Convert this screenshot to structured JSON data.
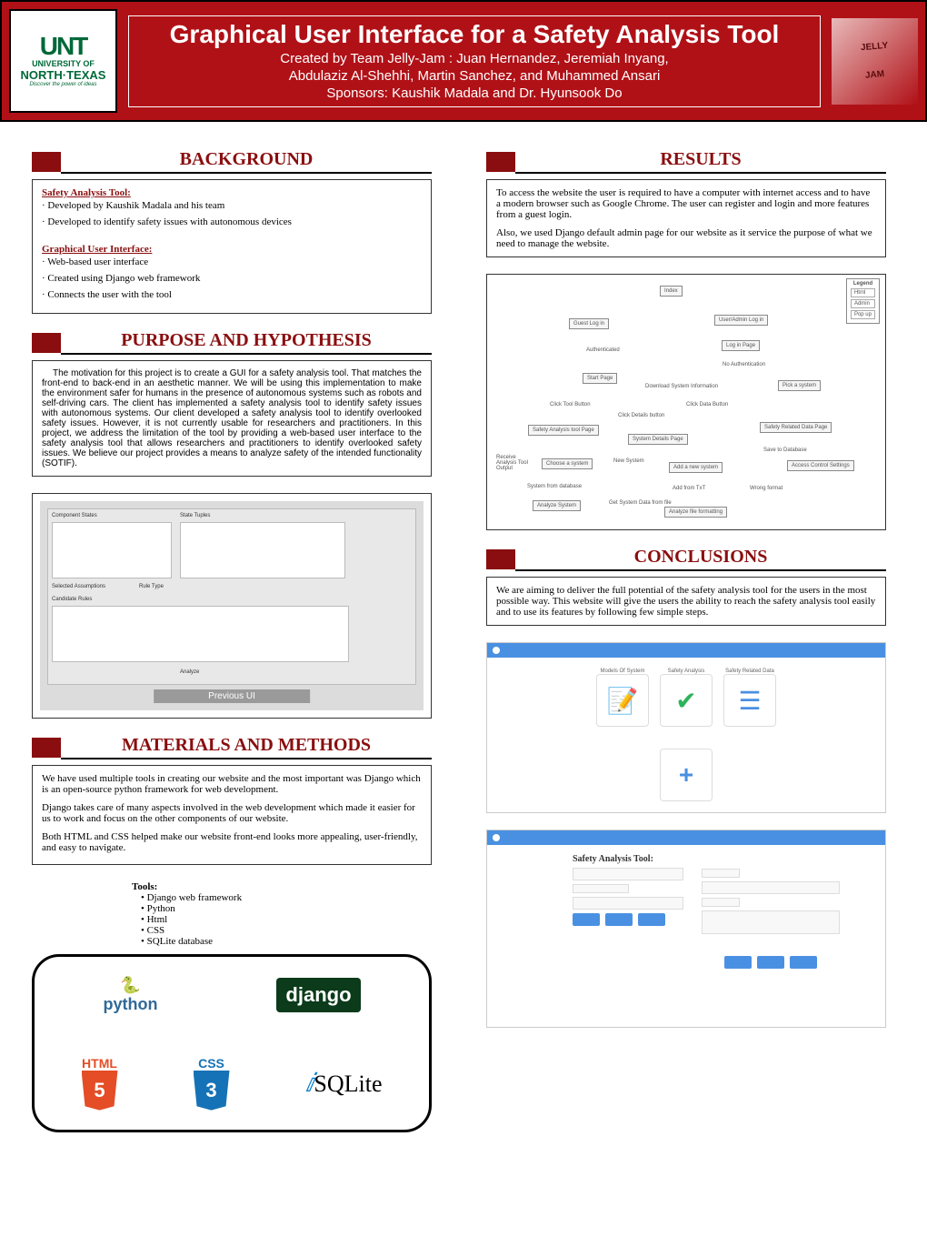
{
  "header": {
    "logo": {
      "big": "UNT",
      "line2": "UNIVERSITY OF",
      "line3": "NORTH·TEXAS",
      "tag": "Discover the power of ideas"
    },
    "title": "Graphical User Interface for a Safety Analysis Tool",
    "sub1": "Created by Team Jelly-Jam : Juan Hernandez, Jeremiah Inyang,",
    "sub2": "Abdulaziz Al-Shehhi, Martin Sanchez, and Muhammed Ansari",
    "sub3": "Sponsors: Kaushik Madala and Dr. Hyunsook Do",
    "right_top": "JELLY",
    "right_bottom": "JAM"
  },
  "background": {
    "title": "BACKGROUND",
    "h1": "Safety Analysis Tool:",
    "l1": "· Developed by Kaushik Madala and his team",
    "l2": "· Developed to identify safety issues with autonomous devices",
    "h2": "Graphical User Interface:",
    "l3": "· Web-based user interface",
    "l4": "· Created using Django web framework",
    "l5": "· Connects the user with the tool"
  },
  "purpose": {
    "title": "PURPOSE AND HYPOTHESIS",
    "text": "The motivation for this project is to create a GUI for a safety analysis tool. That matches the front-end to back-end in an aesthetic manner. We will be using this implementation to make the environment safer for humans in the presence of autonomous systems such as robots and self-driving cars. The client has implemented a safety analysis tool to identify safety issues with autonomous systems. Our client developed a safety analysis tool to identify overlooked safety issues. However, it is not currently usable for researchers and practitioners. In this project, we address the limitation of the tool by providing a web-based user interface to the safety analysis tool that allows researchers and practitioners to identify overlooked safety issues. We believe our project provides a means to analyze safety of the intended functionality (SOTIF).",
    "caption": "Previous UI"
  },
  "materials": {
    "title": "MATERIALS AND METHODS",
    "p1": "We have used multiple tools in creating our website and the most important was Django which is an open-source python framework for web development.",
    "p2": "Django takes care of many aspects involved in the web development which made it easier for us to work and focus on the other components  of our website.",
    "p3": "Both HTML and CSS helped make our website front-end looks more appealing, user-friendly, and easy to navigate.",
    "tools_header": "Tools:",
    "tools": [
      "• Django web framework",
      "• Python",
      "• Html",
      "• CSS",
      "• SQLite database"
    ],
    "logos": {
      "python": "python",
      "django": "django",
      "html": "HTML",
      "css": "CSS",
      "sqlite": "SQLite"
    }
  },
  "results": {
    "title": "RESULTS",
    "p1": "To access the website the user is required to have a computer with internet access and to have a modern browser such as Google Chrome. The user can register and login and more features from a guest login.",
    "p2": "Also, we used Django default admin page for our website as it service the purpose of what we need to manage the website.",
    "legend_title": "Legend",
    "legend": [
      "Html",
      "Admin",
      "Pop up"
    ],
    "nodes": {
      "index": "Index",
      "guest": "Guest Log in",
      "useradmin": "User/Admin Log in",
      "auth": "Authenticated",
      "loginpage": "Log in Page",
      "noauth": "No Authentication",
      "start": "Start Page",
      "download": "Download System Information",
      "pick": "Pick a system",
      "clicktool": "Click Tool Button",
      "clickdata": "Click Data Button",
      "clickdetails": "Click Details button",
      "satool": "Safety Analysis tool Page",
      "sysdetails": "System Details Page",
      "srdata": "Safety Related Data Page",
      "save": "Save to Database",
      "output": "Receive Analysis Tool Output",
      "choose": "Choose a system",
      "newsys": "New System",
      "addnew": "Add a new system",
      "access": "Access Control Settings",
      "sysfromdb": "System from database",
      "addtxt": "Add from TxT",
      "wrongfmt": "Wrong format",
      "analyze": "Analyze System",
      "getsys": "Get System Data from file",
      "analyzefile": "Analyze file formatting"
    }
  },
  "conclusions": {
    "title": "CONCLUSIONS",
    "text": "We are aiming to deliver the full potential of the safety analysis tool for the users in the most possible way. This website will give the users the ability to reach the safety analysis tool easily and to use its features by following few simple steps."
  },
  "mock": {
    "card_labels": [
      "Models Of System",
      "Safety Analysis",
      "Safety Related Data"
    ],
    "plus": "+",
    "form_title": "Safety Analysis Tool:"
  }
}
